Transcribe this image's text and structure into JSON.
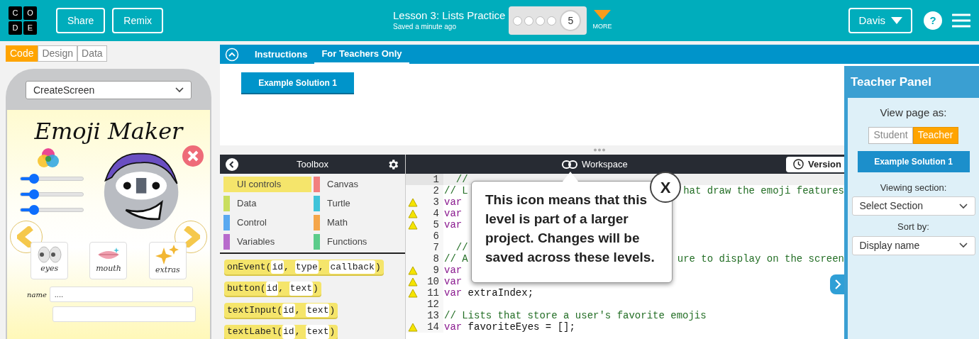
{
  "header": {
    "logo": [
      "C",
      "O",
      "D",
      "E"
    ],
    "buttons": [
      "Share",
      "Remix"
    ],
    "title": "Lesson 3: Lists Practice",
    "subtitle": "Saved a minute ago",
    "levels": [
      {
        "selected": false
      },
      {
        "selected": false
      },
      {
        "selected": false
      },
      {
        "selected": false
      },
      {
        "label": "5",
        "selected": true
      }
    ],
    "more": "MORE",
    "user": "Davis",
    "help": "?"
  },
  "mode_tabs": [
    {
      "label": "Code",
      "selected": true
    },
    {
      "label": "Design",
      "selected": false
    },
    {
      "label": "Data",
      "selected": false
    }
  ],
  "app_preview": {
    "screen": "CreateScreen",
    "title": "Emoji Maker",
    "sliders": [
      {
        "level": 0.22
      },
      {
        "level": 0.22
      },
      {
        "level": 0.22
      }
    ],
    "options": [
      "eyes",
      "mouth",
      "extras"
    ],
    "name_label": "name",
    "name_value": "...."
  },
  "instructions": {
    "tabs": [
      {
        "label": "Instructions",
        "selected": false
      },
      {
        "label": "For Teachers Only",
        "selected": true
      }
    ],
    "button": "Example Solution 1"
  },
  "toolbox": {
    "title": "Toolbox",
    "categories": [
      {
        "label": "UI controls",
        "color": "#f5e56b",
        "selected": true
      },
      {
        "label": "Canvas",
        "color": "#f27f7f",
        "selected": false
      },
      {
        "label": "Data",
        "color": "#c9de5f",
        "selected": false
      },
      {
        "label": "Turtle",
        "color": "#3fc3d9",
        "selected": false
      },
      {
        "label": "Control",
        "color": "#5aa9f0",
        "selected": false
      },
      {
        "label": "Math",
        "color": "#f5a64a",
        "selected": false
      },
      {
        "label": "Variables",
        "color": "#b86bcc",
        "selected": false
      },
      {
        "label": "Functions",
        "color": "#5ccc8a",
        "selected": false
      }
    ],
    "blocks": [
      [
        "onEvent(",
        "id",
        ", ",
        "type",
        ", ",
        "callback",
        ")"
      ],
      [
        "button(",
        "id",
        ", ",
        "text",
        ")"
      ],
      [
        "textInput(",
        "id",
        ", ",
        "text",
        ")"
      ],
      [
        "textLabel(",
        "id",
        ", ",
        "text",
        ")"
      ]
    ]
  },
  "workspace": {
    "title": "Workspace",
    "version_button": "Version",
    "lines": [
      {
        "number": "1",
        "comment": "  //",
        "current": true,
        "warning": false
      },
      {
        "number": "2",
        "comment": "// L",
        "tail": "hat draw the emoji features",
        "current": false,
        "warning": false
      },
      {
        "number": "3",
        "keyword": "var",
        "current": false,
        "warning": true
      },
      {
        "number": "4",
        "keyword": "var",
        "current": false,
        "warning": true
      },
      {
        "number": "5",
        "keyword": "var",
        "current": false,
        "warning": true
      },
      {
        "number": "6",
        "current": false,
        "warning": false
      },
      {
        "number": "7",
        "comment": "  //",
        "current": false,
        "warning": false
      },
      {
        "number": "8",
        "comment": "// A",
        "tail": "ure to display on the screen",
        "current": false,
        "warning": false
      },
      {
        "number": "9",
        "keyword": "var",
        "current": false,
        "warning": true
      },
      {
        "number": "10",
        "keyword": "var",
        "current": false,
        "warning": true
      },
      {
        "number": "11",
        "keyword": "var",
        "code": " extraIndex;",
        "current": false,
        "warning": true
      },
      {
        "number": "12",
        "current": false,
        "warning": false
      },
      {
        "number": "13",
        "comment": "// Lists that store a user's favorite emojis",
        "current": false,
        "warning": false
      },
      {
        "number": "14",
        "keyword": "var",
        "code": " favoriteEyes = [];",
        "current": false,
        "warning": true
      }
    ]
  },
  "tooltip": {
    "text": "This icon means that this level is part of a larger project. Changes will be saved across these levels.",
    "close": "X"
  },
  "teacher_panel": {
    "title": "Teacher Panel",
    "view_label": "View page as:",
    "view_options": [
      {
        "label": "Student",
        "selected": false
      },
      {
        "label": "Teacher",
        "selected": true
      }
    ],
    "button": "Example Solution 1",
    "section_label": "Viewing section:",
    "section_value": "Select Section",
    "sort_label": "Sort by:",
    "sort_value": "Display name"
  }
}
